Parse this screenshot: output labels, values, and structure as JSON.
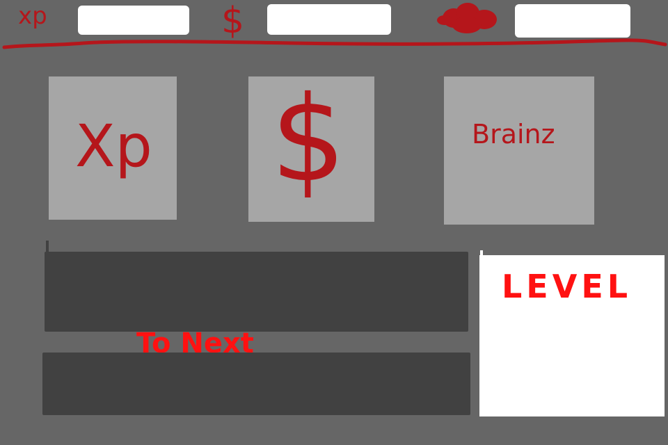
{
  "status_bar": {
    "xp_label": "xp",
    "money_label": "$",
    "brains_icon": "brain-icon",
    "xp_value": "",
    "money_value": "",
    "brains_value": ""
  },
  "tiles": {
    "xp": "Xp",
    "money": "$",
    "brains": "Brainz"
  },
  "progress": {
    "xp_bar_fraction": 0,
    "next_bar_fraction": 0,
    "to_next_label": "To Next"
  },
  "level": {
    "label": "LEVEL",
    "value": ""
  },
  "colors": {
    "background": "#666666",
    "accent_dark_red": "#b5161b",
    "accent_bright_red": "#ff1111",
    "tile": "#a6a6a6",
    "bar": "#414141",
    "field": "#ffffff"
  }
}
